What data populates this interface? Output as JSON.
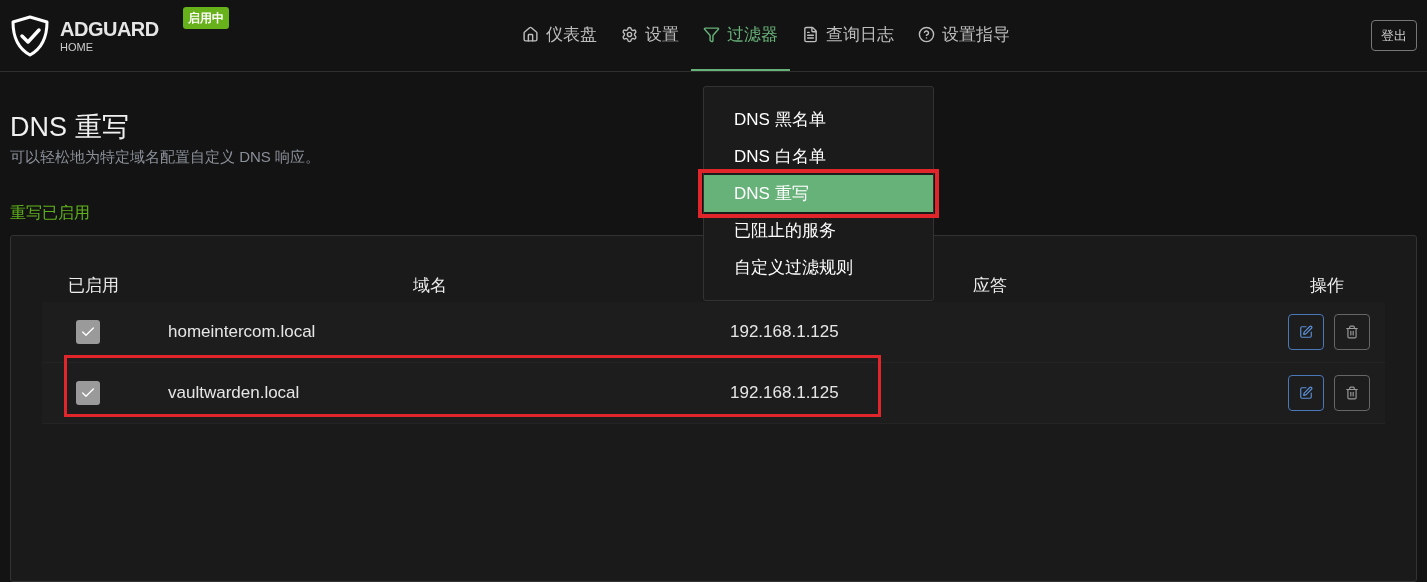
{
  "header": {
    "logo_title": "ADGUARD",
    "logo_subtitle": "HOME",
    "status_badge": "启用中",
    "logout": "登出"
  },
  "nav": [
    {
      "kind": "home",
      "label": "仪表盘",
      "selected": false
    },
    {
      "kind": "gear",
      "label": "设置",
      "selected": false
    },
    {
      "kind": "filter",
      "label": "过滤器",
      "selected": true
    },
    {
      "kind": "doc",
      "label": "查询日志",
      "selected": false
    },
    {
      "kind": "help",
      "label": "设置指导",
      "selected": false
    }
  ],
  "dropdown": [
    {
      "label": "DNS 黑名单",
      "selected": false,
      "highlighted": false
    },
    {
      "label": "DNS 白名单",
      "selected": false,
      "highlighted": false
    },
    {
      "label": "DNS 重写",
      "selected": true,
      "highlighted": true
    },
    {
      "label": "已阻止的服务",
      "selected": false,
      "highlighted": false
    },
    {
      "label": "自定义过滤规则",
      "selected": false,
      "highlighted": false
    }
  ],
  "page": {
    "title": "DNS 重写",
    "subtitle": "可以轻松地为特定域名配置自定义 DNS 响应。",
    "status": "重写已启用"
  },
  "table": {
    "columns": [
      "已启用",
      "域名",
      "应答",
      "操作"
    ],
    "rows": [
      {
        "checked": true,
        "domain": "homeintercom.local",
        "answer": "192.168.1.125",
        "highlighted": false
      },
      {
        "checked": true,
        "domain": "vaultwarden.local",
        "answer": "192.168.1.125",
        "highlighted": true
      }
    ]
  }
}
